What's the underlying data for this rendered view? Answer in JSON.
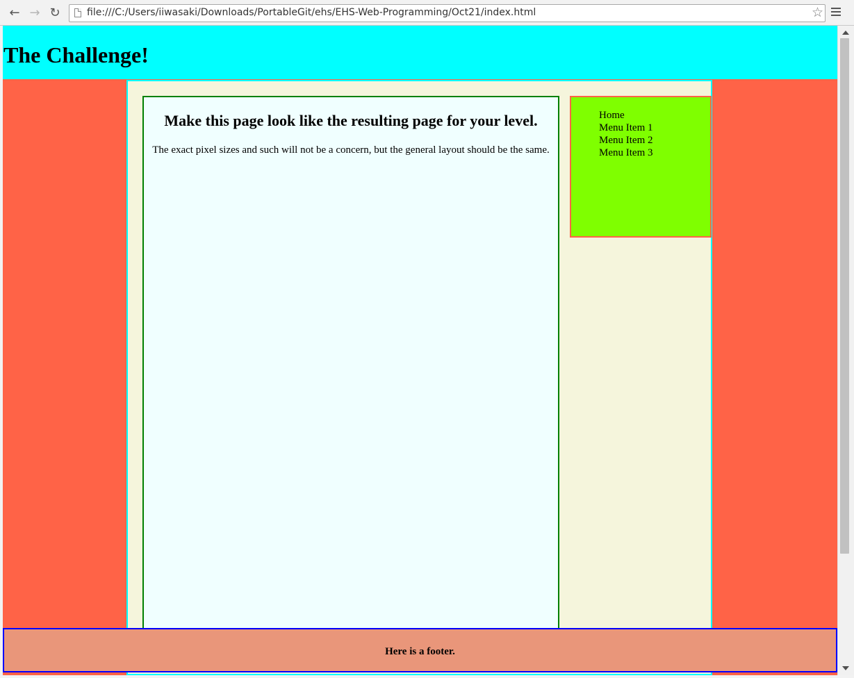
{
  "browser": {
    "url": "file:///C:/Users/iiwasaki/Downloads/PortableGit/ehs/EHS-Web-Programming/Oct21/index.html",
    "icons": [
      "back-arrow-icon",
      "forward-arrow-icon",
      "reload-icon",
      "page-icon",
      "star-icon",
      "menu-icon"
    ]
  },
  "page": {
    "header": {
      "title": "The Challenge!"
    },
    "content": {
      "heading": "Make this page look like the resulting page for your level.",
      "paragraph": "The exact pixel sizes and such will not be a concern, but the general layout should be the same."
    },
    "sidebar": {
      "items": [
        "Home",
        "Menu Item 1",
        "Menu Item 2",
        "Menu Item 3"
      ]
    },
    "footer": {
      "text": "Here is a footer."
    }
  },
  "colors": {
    "header_bg": "#00ffff",
    "page_bg": "#ff6347",
    "wrapper_bg": "#f5f5dc",
    "content_bg": "#f0ffff",
    "content_border": "#008000",
    "sidebar_bg": "#7fff00",
    "footer_bg": "#e9967a",
    "footer_border": "#0000ff"
  }
}
